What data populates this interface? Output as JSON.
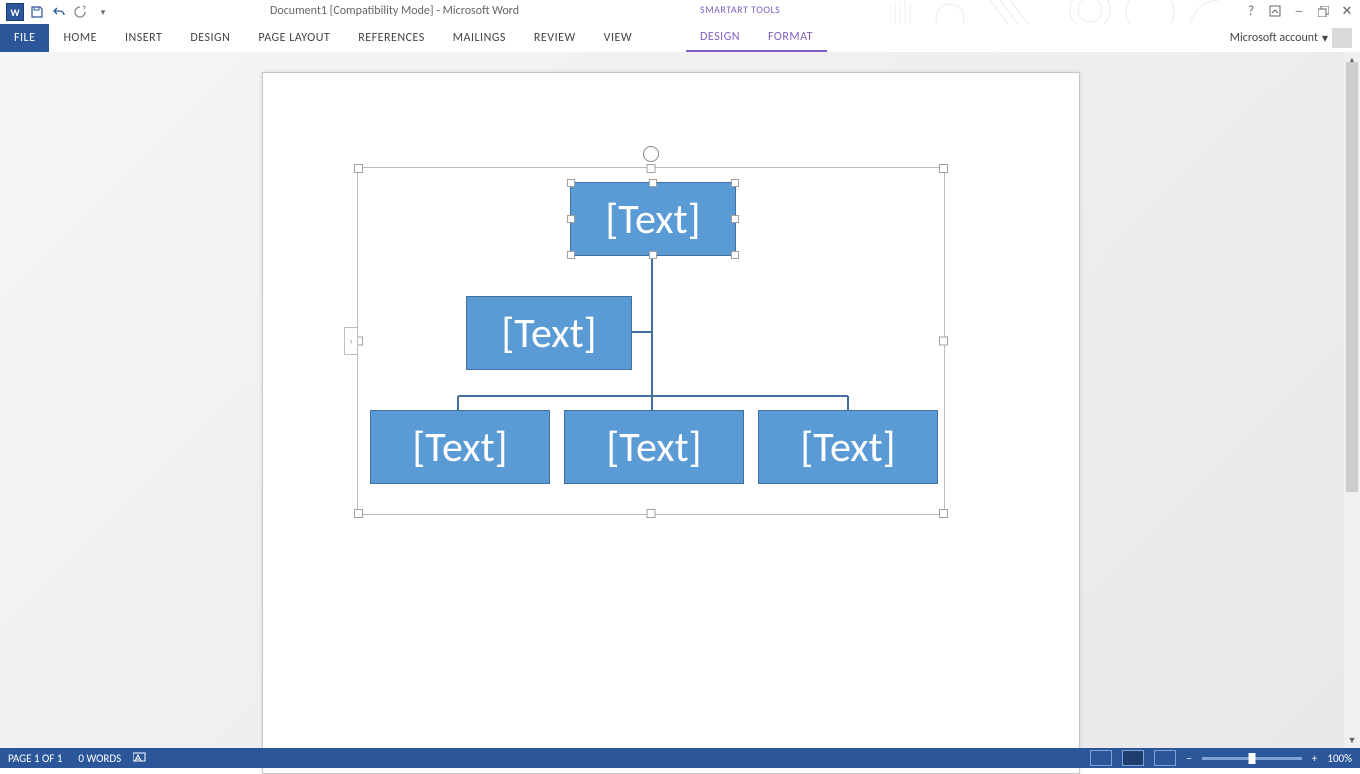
{
  "quickAccess": {
    "appInitial": "W"
  },
  "title": "Document1 [Compatibility Mode] - Microsoft Word",
  "contextualTitle": "SMARTART TOOLS",
  "tabs": {
    "file": "FILE",
    "home": "HOME",
    "insert": "INSERT",
    "design": "DESIGN",
    "pageLayout": "PAGE LAYOUT",
    "references": "REFERENCES",
    "mailings": "MAILINGS",
    "review": "REVIEW",
    "view": "VIEW",
    "ctxDesign": "DESIGN",
    "ctxFormat": "FORMAT"
  },
  "account": {
    "label": "Microsoft account",
    "dropdown": "▾"
  },
  "smartart": {
    "nodes": {
      "top": "[Text]",
      "assistant": "[Text]",
      "child1": "[Text]",
      "child2": "[Text]",
      "child3": "[Text]"
    },
    "expandGlyph": "‹"
  },
  "status": {
    "page": "PAGE 1 OF 1",
    "words": "0 WORDS",
    "zoom": "100%",
    "minus": "−",
    "plus": "+"
  }
}
